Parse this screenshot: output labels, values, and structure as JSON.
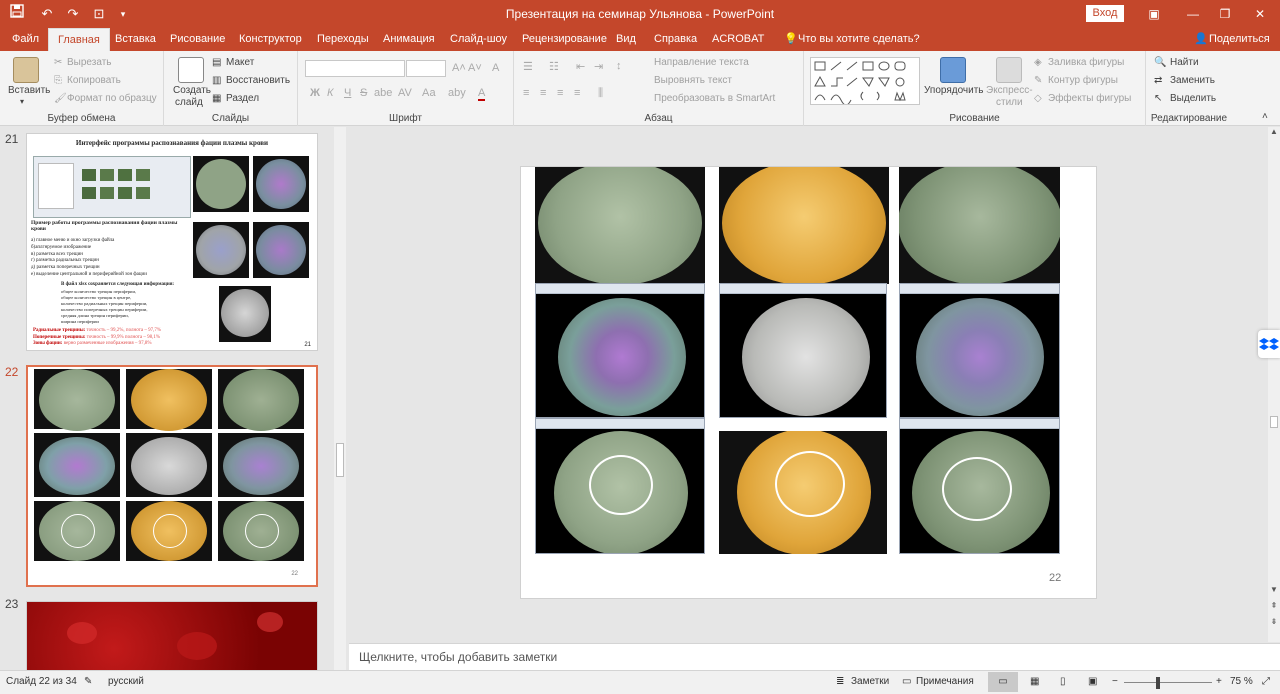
{
  "window": {
    "title": "Презентация на семинар Ульянова  -  PowerPoint",
    "login_label": "Вход"
  },
  "quick_access": [
    "save-icon",
    "undo-icon",
    "redo-icon",
    "slideshow-start-icon",
    "customize-icon"
  ],
  "tabs": [
    {
      "label": "Файл",
      "active": false
    },
    {
      "label": "Главная",
      "active": true
    },
    {
      "label": "Вставка",
      "active": false
    },
    {
      "label": "Рисование",
      "active": false
    },
    {
      "label": "Конструктор",
      "active": false
    },
    {
      "label": "Переходы",
      "active": false
    },
    {
      "label": "Анимация",
      "active": false
    },
    {
      "label": "Слайд-шоу",
      "active": false
    },
    {
      "label": "Рецензирование",
      "active": false
    },
    {
      "label": "Вид",
      "active": false
    },
    {
      "label": "Справка",
      "active": false
    },
    {
      "label": "ACROBAT",
      "active": false
    }
  ],
  "tell_me": "Что вы хотите сделать?",
  "share_label": "Поделиться",
  "ribbon": {
    "clipboard": {
      "group_label": "Буфер обмена",
      "paste": "Вставить",
      "cut": "Вырезать",
      "copy": "Копировать",
      "format_painter": "Формат по образцу"
    },
    "slides": {
      "group_label": "Слайды",
      "new_slide_line1": "Создать",
      "new_slide_line2": "слайд",
      "layout": "Макет",
      "reset": "Восстановить",
      "section": "Раздел"
    },
    "font": {
      "group_label": "Шрифт",
      "bold": "Ж",
      "italic": "К",
      "underline": "Ч",
      "strike": "S",
      "shadow": "abe",
      "grow": "A˄",
      "shrink": "A˅",
      "spacing": "AV",
      "case": "Аа",
      "clear": "A",
      "highlight": "aby",
      "color": "A"
    },
    "paragraph": {
      "group_label": "Абзац",
      "text_direction": "Направление текста",
      "align_text": "Выровнять текст",
      "smartart": "Преобразовать в SmartArt"
    },
    "drawing": {
      "group_label": "Рисование",
      "arrange": "Упорядочить",
      "quick_styles_line1": "Экспресс-",
      "quick_styles_line2": "стили",
      "fill": "Заливка фигуры",
      "outline": "Контур фигуры",
      "effects": "Эффекты фигуры"
    },
    "editing": {
      "group_label": "Редактирование",
      "find": "Найти",
      "replace": "Заменить",
      "select": "Выделить"
    }
  },
  "thumbnails": [
    {
      "number": "21",
      "title": "Интерфейс программы распознавания фации плазмы крови",
      "subtitle": "Пример работы программы распознавания фации плазмы крови",
      "list": [
        "а) главное меню и окно загрузки файла",
        "б)аплгнруемое изображение",
        "в) разметка всех трещин",
        "г) разметка радиальных трещин",
        "д) разметка поперечных трещин",
        "е) выделение центральной и периферийной зон фации"
      ],
      "file_title": "В файл xlsx сохраняется следующая информация:",
      "file_items": [
        "общее количество трещин периферии,",
        "общее количество трещин в центре,",
        "количество радиальных трещин периферии,",
        "количество поперечных трещин периферии,",
        "средняя длина трещин периферии,",
        "ширина периферии"
      ],
      "radial": "Радиальные трещины:",
      "radial_val": "точность – 99,2%, полнота – 97,7%",
      "transverse": "Поперечные трещины:",
      "transverse_val": "точность – 99,9% полнота – 98,1%",
      "zone": "Зоны фации:",
      "zone_val": "верно размеченные изображения – 97,8%",
      "page": "21"
    },
    {
      "number": "22",
      "page": "22"
    },
    {
      "number": "23"
    }
  ],
  "slide": {
    "page_number": "22",
    "colors": {
      "green_disc": "#8fa386",
      "amber_disc": "#e0a53a",
      "grey_disc": "#b9bab7",
      "background": "#111111"
    }
  },
  "notes_placeholder": "Щелкните, чтобы добавить заметки",
  "status": {
    "slide_counter": "Слайд 22 из 34",
    "language": "русский",
    "notes": "Заметки",
    "comments": "Примечания",
    "zoom": "75 %",
    "zoom_fraction": 0.75
  }
}
